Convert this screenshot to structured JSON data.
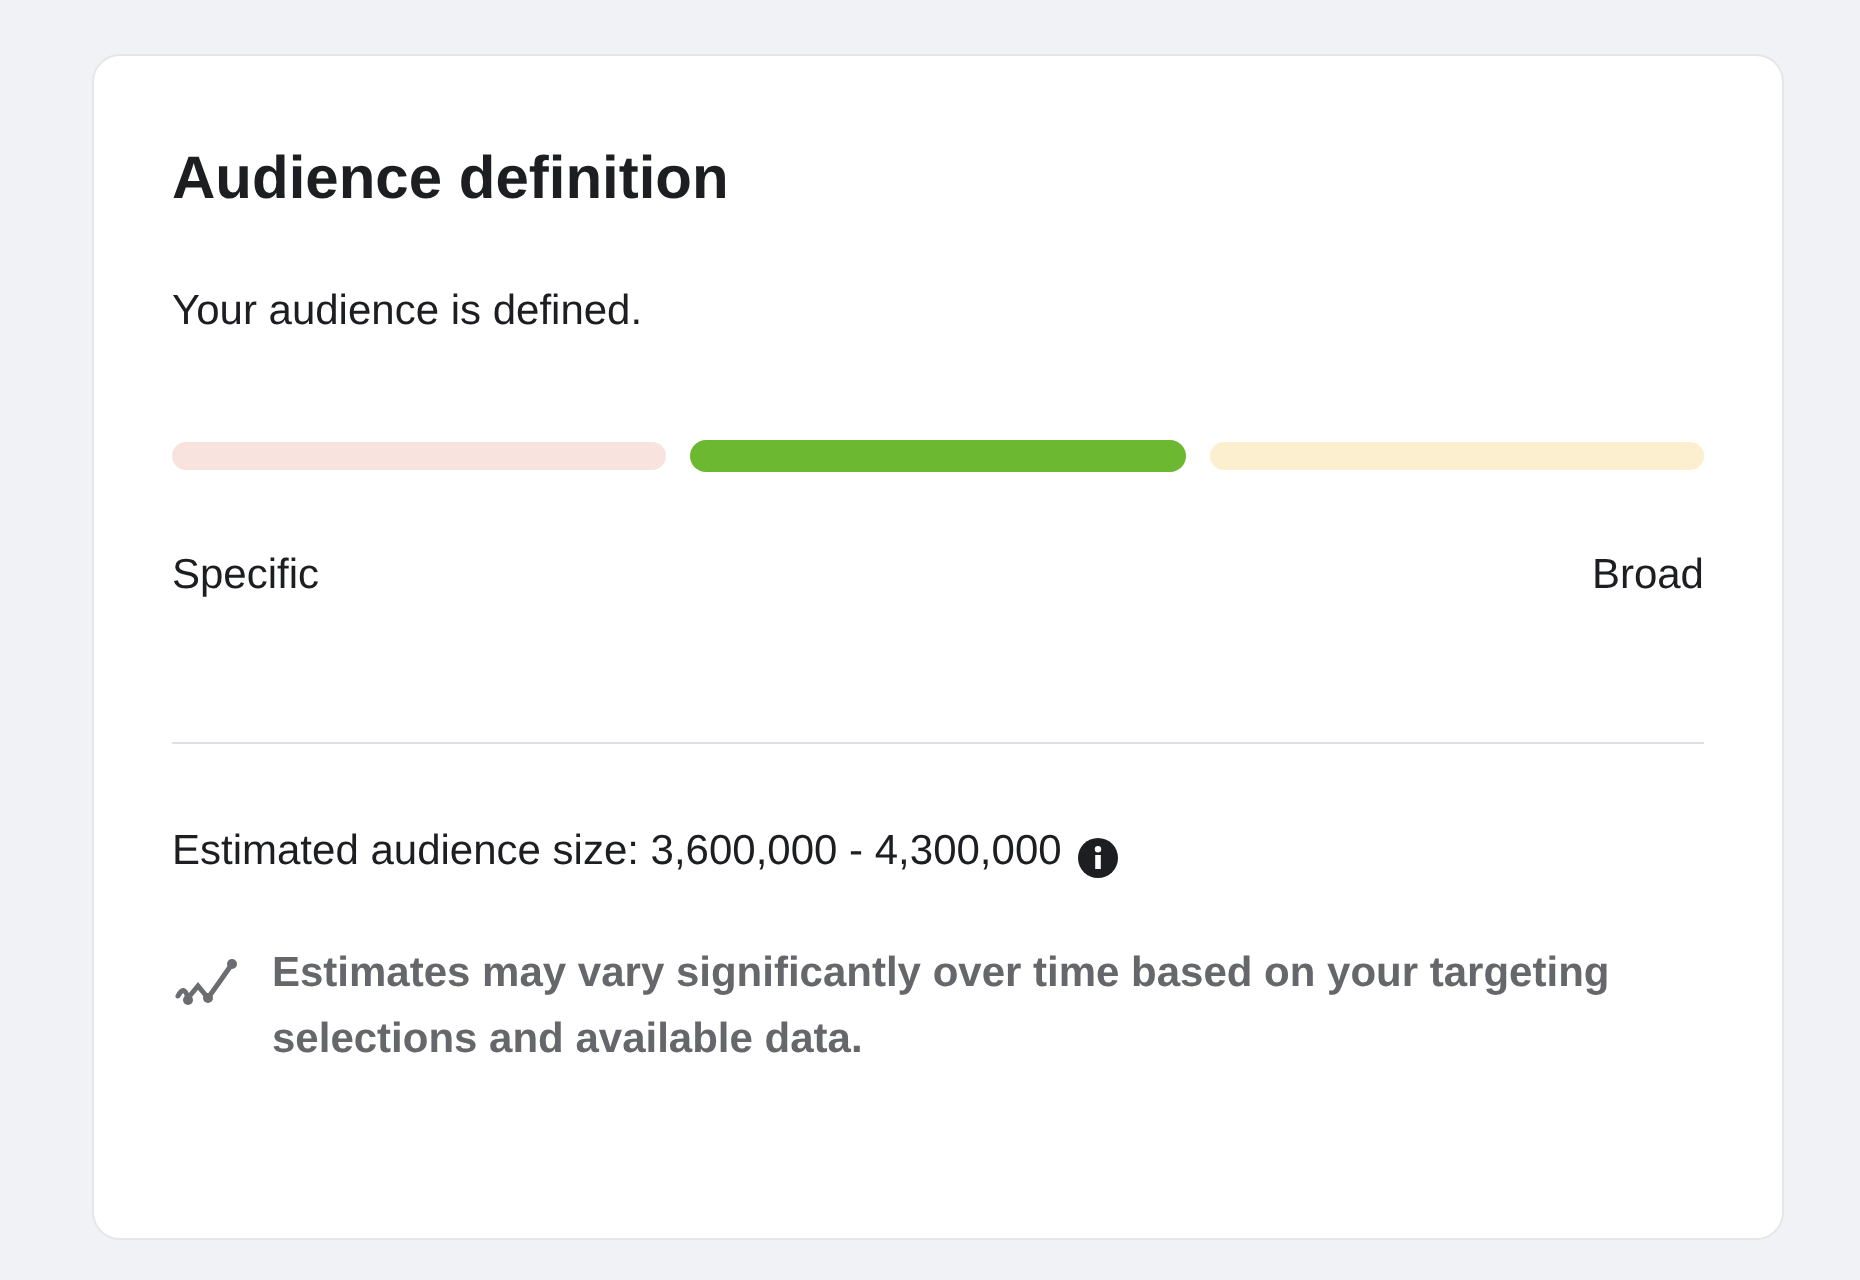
{
  "card": {
    "title": "Audience definition",
    "status": "Your audience is defined.",
    "meter": {
      "segments": [
        {
          "color": "#f9e3df",
          "selected": false
        },
        {
          "color": "#6cb831",
          "selected": true
        },
        {
          "color": "#fcefd0",
          "selected": false
        }
      ],
      "min_label": "Specific",
      "max_label": "Broad"
    },
    "estimate": "Estimated audience size: 3,600,000 - 4,300,000",
    "note": "Estimates may vary significantly over time based on your targeting selections and available data."
  }
}
